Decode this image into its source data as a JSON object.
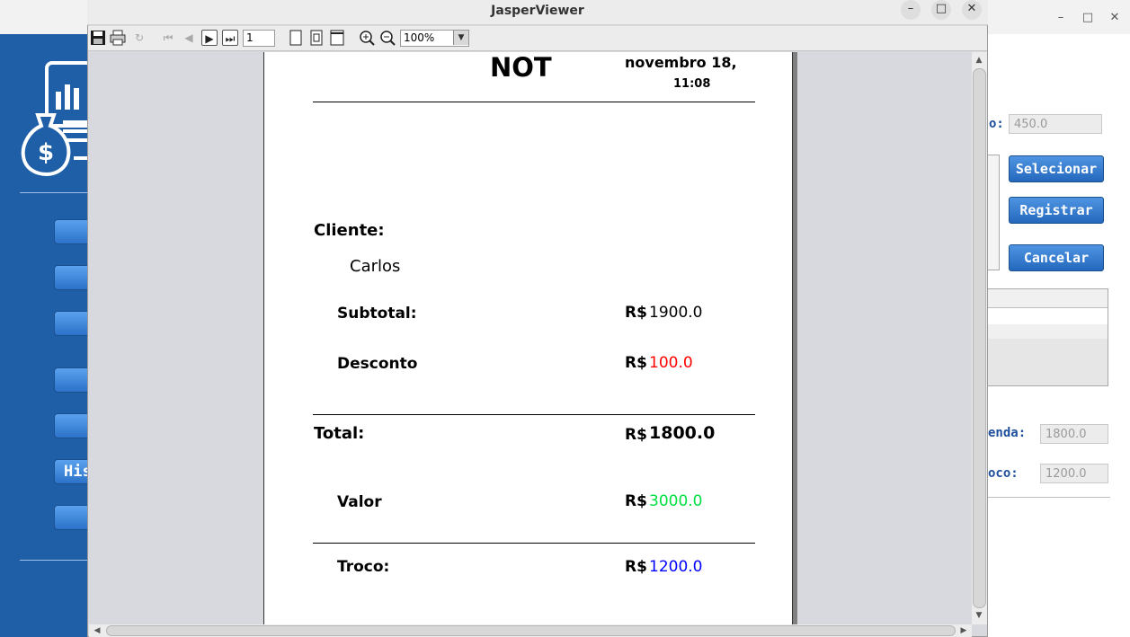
{
  "jasper": {
    "title": "JasperViewer",
    "window_controls": {
      "minimize": "–",
      "maximize": "□",
      "close": "✕"
    },
    "toolbar": {
      "page_number": "1",
      "zoom": "100%"
    }
  },
  "report": {
    "heading": "NOT",
    "date": "novembro 18,",
    "time": "11:08",
    "client_label": "Cliente:",
    "client_name": "Carlos",
    "subtotal_label": "Subtotal:",
    "subtotal_currency": "R$",
    "subtotal_value": "1900.0",
    "discount_label": "Desconto",
    "discount_currency": "R$",
    "discount_value": "100.0",
    "total_label": "Total:",
    "total_currency": "R$",
    "total_value": "1800.0",
    "paid_label": "Valor",
    "paid_currency": "R$",
    "paid_value": "3000.0",
    "change_label": "Troco:",
    "change_currency": "R$",
    "change_value": "1200.0",
    "colors": {
      "discount": "#ff0000",
      "paid": "#00e040",
      "change": "#0000ff"
    }
  },
  "background_app": {
    "window_controls": {
      "minimize": "–",
      "maximize": "□",
      "close": "✕"
    },
    "sidebar_partial_label": "His",
    "field_top_label_partial": "o:",
    "field_top_value": "450.0",
    "select_button": "Selecionar",
    "register_button": "Registrar",
    "cancel_button": "Cancelar",
    "sale_label_partial": "enda:",
    "sale_value": "1800.0",
    "change_label_partial": "oco:",
    "change_value": "1200.0"
  }
}
